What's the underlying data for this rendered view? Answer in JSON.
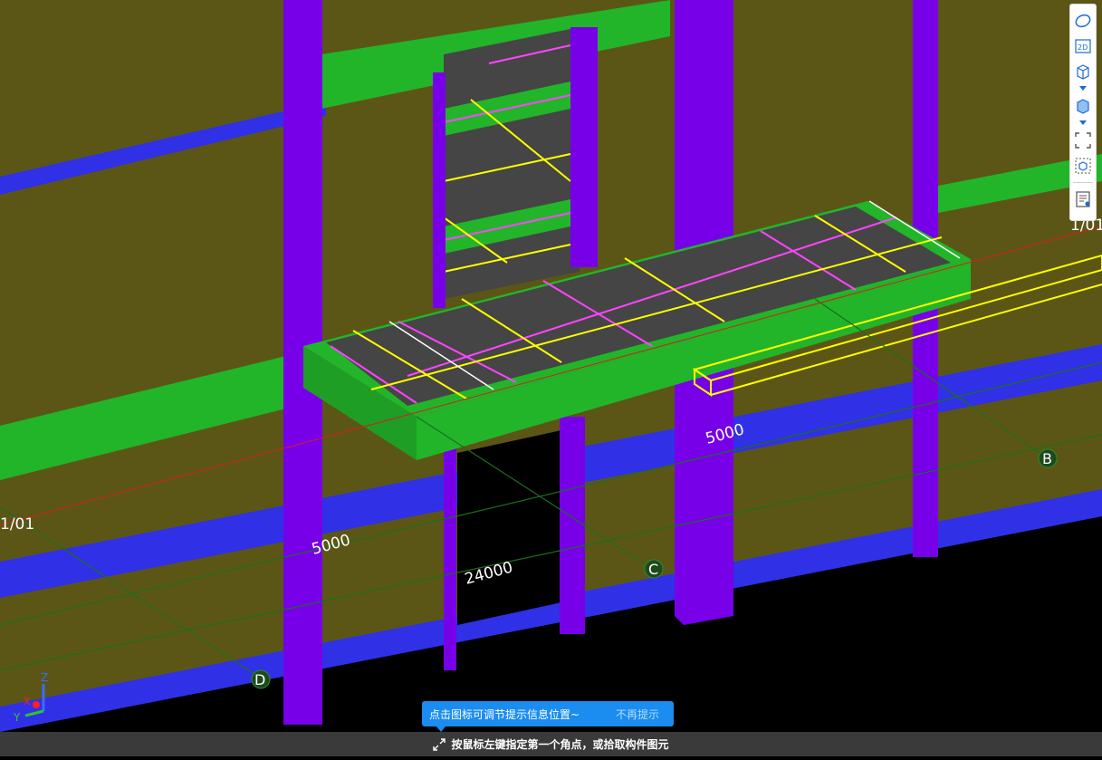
{
  "canvas": {
    "dimension_labels": [
      "5000",
      "5000",
      "24000"
    ],
    "elevation_labels": [
      "1/01",
      "1/01"
    ],
    "axis_markers": [
      "B",
      "C",
      "D"
    ],
    "gizmo": {
      "z": "Z",
      "x": "X",
      "y": "Y"
    }
  },
  "toolbar": {
    "icons": [
      "orbit-icon",
      "2d-view-icon",
      "3d-cube-icon",
      "solid-cube-icon",
      "fit-view-icon",
      "component-view-icon",
      "properties-list-icon"
    ],
    "twod_label": "2D"
  },
  "tip": {
    "message": "点击图标可调节提示信息位置~",
    "dismiss": "不再提示"
  },
  "status": {
    "message": "按鼠标左键指定第一个角点，或拾取构件图元"
  },
  "colors": {
    "wall": "#5c5616",
    "beam": "#22b52a",
    "column": "#7700e8",
    "floor_band": "#3030e6",
    "slab": "#454545",
    "highlight": "#ffff00",
    "rebar": "#ff44ff",
    "tip_bg": "#1b8cf0"
  }
}
